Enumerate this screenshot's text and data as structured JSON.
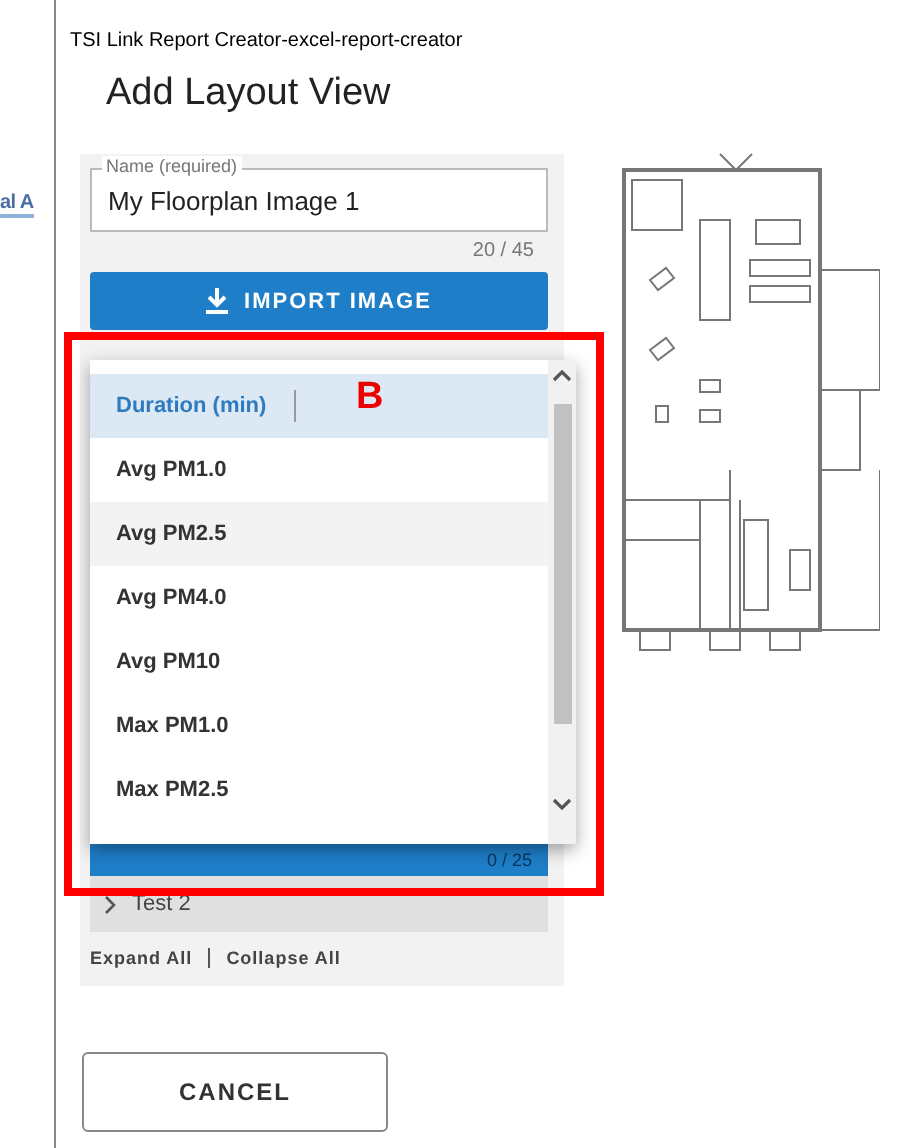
{
  "background_page": {
    "link_text": "al A"
  },
  "window": {
    "title": "TSI Link Report Creator-excel-report-creator"
  },
  "dialog": {
    "title": "Add Layout View"
  },
  "name_field": {
    "label": "Name (required)",
    "value": "My Floorplan Image 1",
    "counter": "20 / 45"
  },
  "import_button": {
    "label": "IMPORT IMAGE"
  },
  "section_bar": {
    "counter": "0 / 25"
  },
  "dropdown": {
    "options": [
      {
        "label": "Duration (min)",
        "selected": true,
        "hovered": false
      },
      {
        "label": "Avg PM1.0",
        "selected": false,
        "hovered": false
      },
      {
        "label": "Avg PM2.5",
        "selected": false,
        "hovered": true
      },
      {
        "label": "Avg PM4.0",
        "selected": false,
        "hovered": false
      },
      {
        "label": "Avg PM10",
        "selected": false,
        "hovered": false
      },
      {
        "label": "Max PM1.0",
        "selected": false,
        "hovered": false
      },
      {
        "label": "Max PM2.5",
        "selected": false,
        "hovered": false
      }
    ]
  },
  "tree": [
    {
      "label": "Test 2",
      "expanded": false
    }
  ],
  "tree_links": [
    "Expand All",
    "Collapse All"
  ],
  "cancel_button": {
    "label": "CANCEL"
  },
  "annotation": {
    "label": "B"
  }
}
